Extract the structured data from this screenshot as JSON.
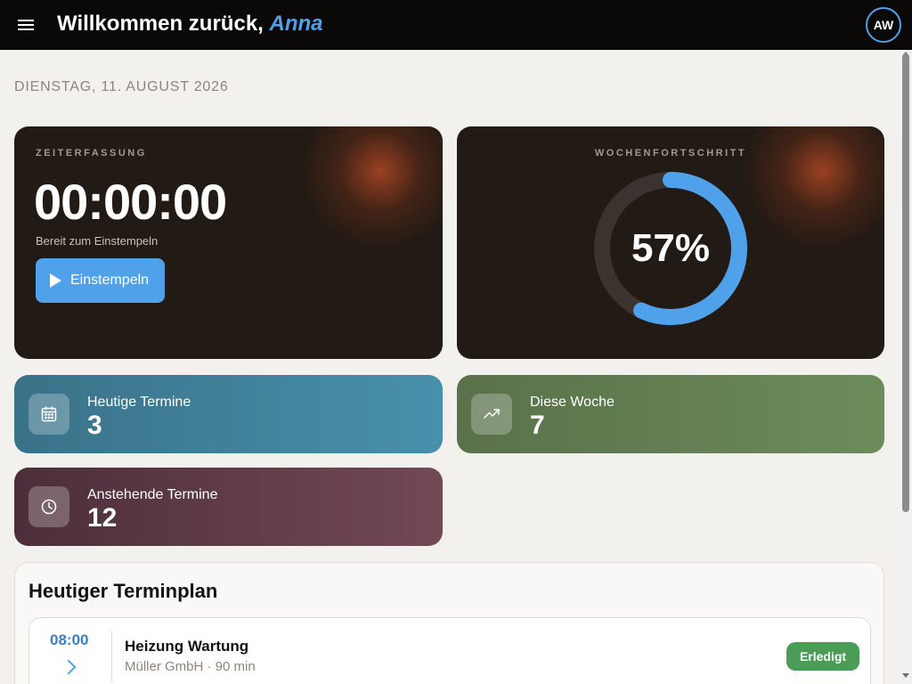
{
  "header": {
    "greeting_prefix": "Willkommen zurück,",
    "user_name": "Anna",
    "avatar_initials": "AW",
    "accent_color": "#4fa1ea"
  },
  "date_label": "DIENSTAG, 11. AUGUST 2026",
  "timer_card": {
    "label": "ZEITERFASSUNG",
    "time": "00:00:00",
    "status": "Bereit zum Einstempeln",
    "button_label": "Einstempeln",
    "button_icon": "play-icon"
  },
  "progress_card": {
    "label": "WOCHENFORTSCHRITT",
    "value_text": "57%",
    "percent": 57,
    "ring_color": "#4fa1ea",
    "track_color": "#3a3330"
  },
  "stats": {
    "today": {
      "title": "Heutige Termine",
      "value": "3",
      "icon": "calendar-icon"
    },
    "week": {
      "title": "Diese Woche",
      "value": "7",
      "icon": "trending-up-icon"
    },
    "upcoming": {
      "title": "Anstehende Termine",
      "value": "12",
      "icon": "clock-icon"
    }
  },
  "schedule": {
    "title": "Heutiger Terminplan",
    "items": [
      {
        "time": "08:00",
        "title": "Heizung Wartung",
        "subtitle": "Müller GmbH · 90 min",
        "status": "Erledigt",
        "status_color": "#4a9c57"
      }
    ]
  }
}
